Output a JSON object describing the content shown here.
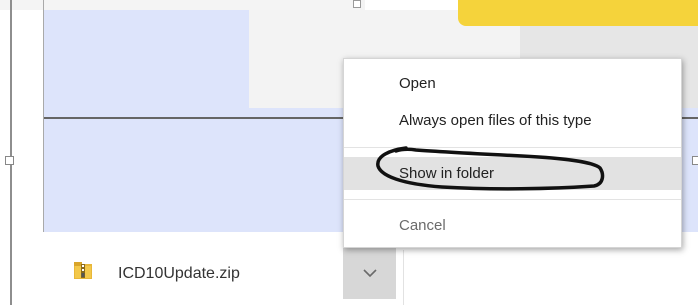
{
  "context_menu": {
    "items": [
      {
        "label": "Open"
      },
      {
        "label": "Always open files of this type"
      },
      {
        "label": "Show in folder"
      },
      {
        "label": "Cancel"
      }
    ],
    "highlighted_item": "Show in folder"
  },
  "download_shelf": {
    "file_name": "ICD10Update.zip",
    "file_icon": "zip-file-icon",
    "dropdown_icon": "chevron-down-icon"
  },
  "colors": {
    "page_panel": "#dde4fb",
    "menu_hover": "#e2e2e2",
    "dropdown_button": "#d7d7d7",
    "accent_yellow": "#f5d33b"
  }
}
